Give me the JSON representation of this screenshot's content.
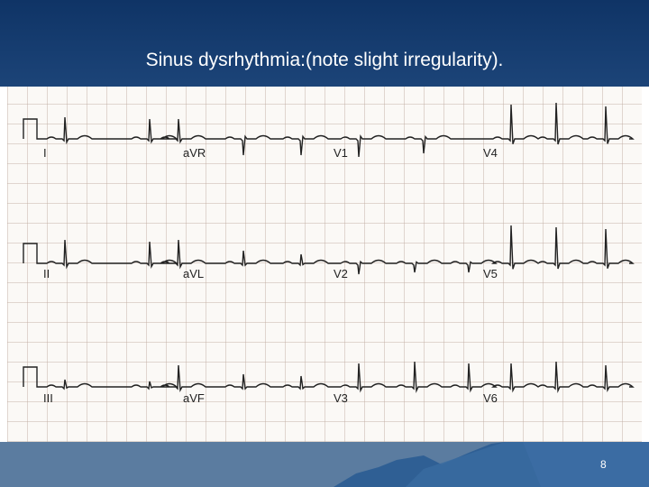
{
  "slide": {
    "title": "Sinus dysrhythmia:(note slight irregularity).",
    "page_number": "8"
  },
  "ecg": {
    "leads": [
      "I",
      "aVR",
      "V1",
      "V4",
      "II",
      "aVL",
      "V2",
      "V5",
      "III",
      "aVF",
      "V3",
      "V6"
    ]
  },
  "colors": {
    "header": "#0f3466",
    "footer": "#5b7ca0",
    "trace": "#222222"
  }
}
